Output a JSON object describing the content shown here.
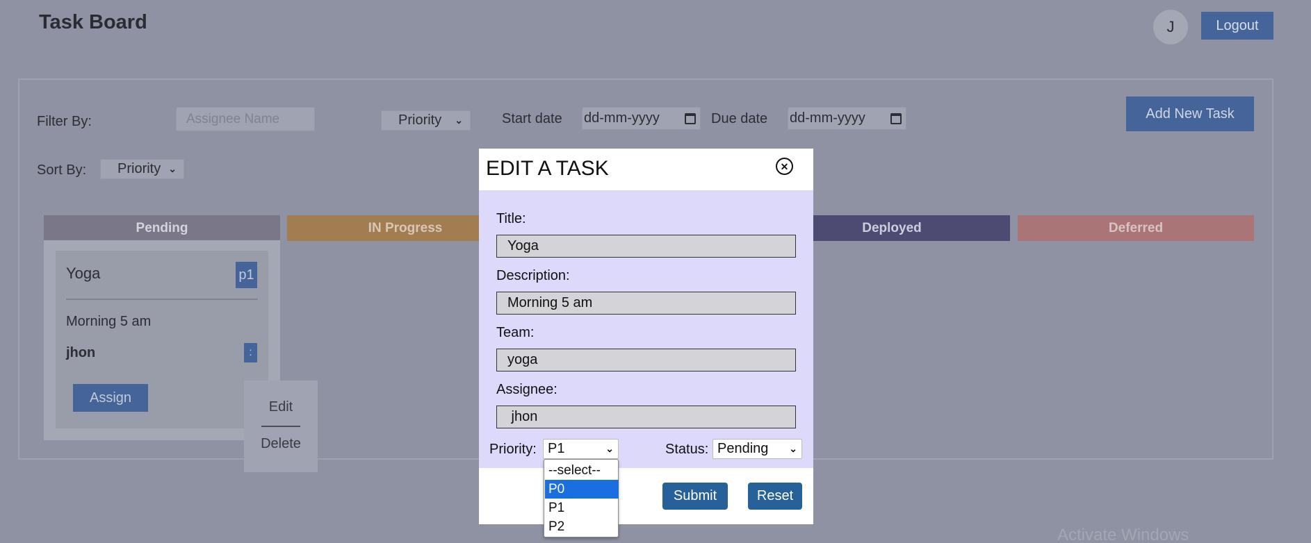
{
  "header": {
    "title": "Task Board",
    "avatar_initial": "J",
    "logout_label": "Logout"
  },
  "filters": {
    "filter_by_label": "Filter By:",
    "assignee_placeholder": "Assignee Name",
    "priority_select": "Priority",
    "start_date_label": "Start date",
    "start_date_value": "dd-mm-yyyy",
    "due_date_label": "Due date",
    "due_date_value": "dd-mm-yyyy",
    "sort_by_label": "Sort By:",
    "sort_select": "Priority",
    "add_task_label": "Add New Task"
  },
  "columns": [
    {
      "label": "Pending",
      "color": "#7a7888",
      "text_color": "#d3d3dc"
    },
    {
      "label": "IN Progress",
      "color": "#a27d52",
      "text_color": "#d9c7b3"
    },
    {
      "label": "Deployed",
      "color": "#4d4b72",
      "text_color": "#cdcdde"
    },
    {
      "label": "Deferred",
      "color": "#a97577",
      "text_color": "#d8c3c4"
    }
  ],
  "task_card": {
    "title": "Yoga",
    "priority": "p1",
    "description": "Morning 5 am",
    "assignee": "jhon",
    "more_label": ":",
    "assign_label": "Assign"
  },
  "context_menu": {
    "edit_label": "Edit",
    "delete_label": "Delete"
  },
  "modal": {
    "title": "EDIT A TASK",
    "close_icon": "close-icon",
    "title_label": "Title:",
    "title_value": "Yoga",
    "description_label": "Description:",
    "description_value": "Morning 5 am",
    "team_label": "Team:",
    "team_value": "yoga",
    "assignee_label": "Assignee:",
    "assignee_value": " jhon",
    "priority_label": "Priority:",
    "priority_value": "P1",
    "status_label": "Status:",
    "status_value": "Pending",
    "submit_label": "Submit",
    "reset_label": "Reset",
    "priority_options": [
      "--select--",
      "P0",
      "P1",
      "P2"
    ],
    "highlighted_option": "P0"
  },
  "watermark": "Activate Windows"
}
